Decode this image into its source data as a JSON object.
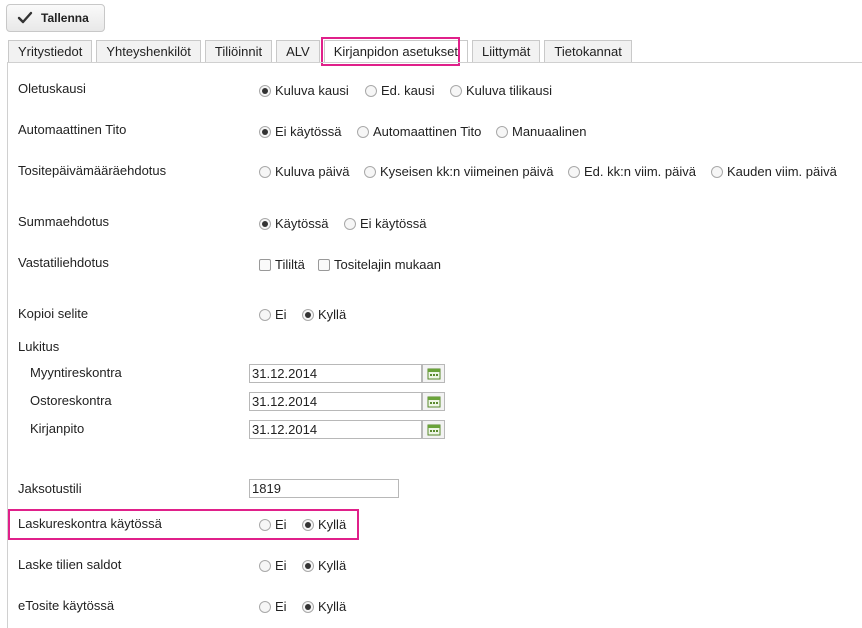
{
  "toolbar": {
    "save_label": "Tallenna"
  },
  "tabs": [
    {
      "label": "Yritystiedot"
    },
    {
      "label": "Yhteyshenkilöt"
    },
    {
      "label": "Tiliöinnit"
    },
    {
      "label": "ALV"
    },
    {
      "label": "Kirjanpidon asetukset",
      "active": true
    },
    {
      "label": "Liittymät"
    },
    {
      "label": "Tietokannat"
    }
  ],
  "settings": {
    "oletuskausi": {
      "label": "Oletuskausi",
      "options": [
        "Kuluva kausi",
        "Ed. kausi",
        "Kuluva tilikausi"
      ],
      "selected": "Kuluva kausi"
    },
    "tito": {
      "label": "Automaattinen Tito",
      "options": [
        "Ei käytössä",
        "Automaattinen Tito",
        "Manuaalinen"
      ],
      "selected": "Ei käytössä"
    },
    "tositepvm": {
      "label": "Tositepäivämääräehdotus",
      "options": [
        "Kuluva päivä",
        "Kyseisen kk:n viimeinen päivä",
        "Ed. kk:n viim. päivä",
        "Kauden viim. päivä"
      ],
      "selected": null
    },
    "summa": {
      "label": "Summaehdotus",
      "options": [
        "Käytössä",
        "Ei käytössä"
      ],
      "selected": "Käytössä"
    },
    "vastatili": {
      "label": "Vastatiliehdotus",
      "checkboxes": [
        "Tililtä",
        "Tositelajin mukaan"
      ]
    },
    "kopioi": {
      "label": "Kopioi selite",
      "options": [
        "Ei",
        "Kyllä"
      ],
      "selected": "Kyllä"
    },
    "lukitus": {
      "label": "Lukitus",
      "rows": [
        {
          "label": "Myyntireskontra",
          "value": "31.12.2014"
        },
        {
          "label": "Ostoreskontra",
          "value": "31.12.2014"
        },
        {
          "label": "Kirjanpito",
          "value": "31.12.2014"
        }
      ]
    },
    "jaksotus": {
      "label": "Jaksotustili",
      "value": "1819"
    },
    "laskureskontra": {
      "label": "Laskureskontra käytössä",
      "options": [
        "Ei",
        "Kyllä"
      ],
      "selected": "Kyllä"
    },
    "saldot": {
      "label": "Laske tilien saldot",
      "options": [
        "Ei",
        "Kyllä"
      ],
      "selected": "Kyllä"
    },
    "etosite": {
      "label": "eTosite käytössä",
      "options": [
        "Ei",
        "Kyllä"
      ],
      "selected": "Kyllä"
    }
  },
  "colors": {
    "highlight": "#e0208a"
  }
}
